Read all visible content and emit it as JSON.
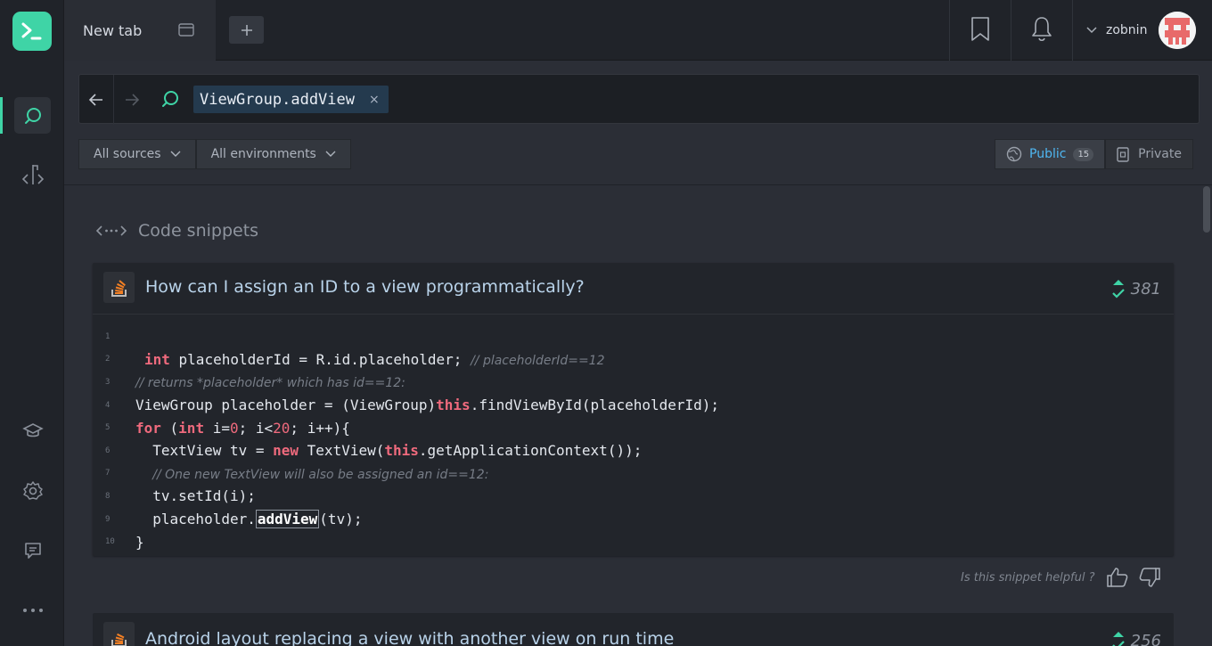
{
  "tab": {
    "label": "New tab"
  },
  "user": {
    "name": "zobnin"
  },
  "search": {
    "query": "ViewGroup.addView",
    "clear": "×"
  },
  "filters": {
    "sources": "All sources",
    "environments": "All environments"
  },
  "visibility": {
    "public": "Public",
    "public_count": "15",
    "private": "Private"
  },
  "section": {
    "title": "Code snippets"
  },
  "snippet": {
    "title": "How can I assign an ID to a view programmatically?",
    "votes": "381",
    "lines": [
      "1",
      "2",
      "3",
      "4",
      "5",
      "6",
      "7",
      "8",
      "9",
      "10"
    ]
  },
  "helpful": {
    "text": "Is this snippet helpful ?"
  },
  "snippet2": {
    "title": "Android layout replacing a view with another view on run time",
    "votes": "256"
  },
  "colors": {
    "accent": "#3fd4a6",
    "public": "#4fb7f2",
    "keyword": "#ef6a7d"
  }
}
